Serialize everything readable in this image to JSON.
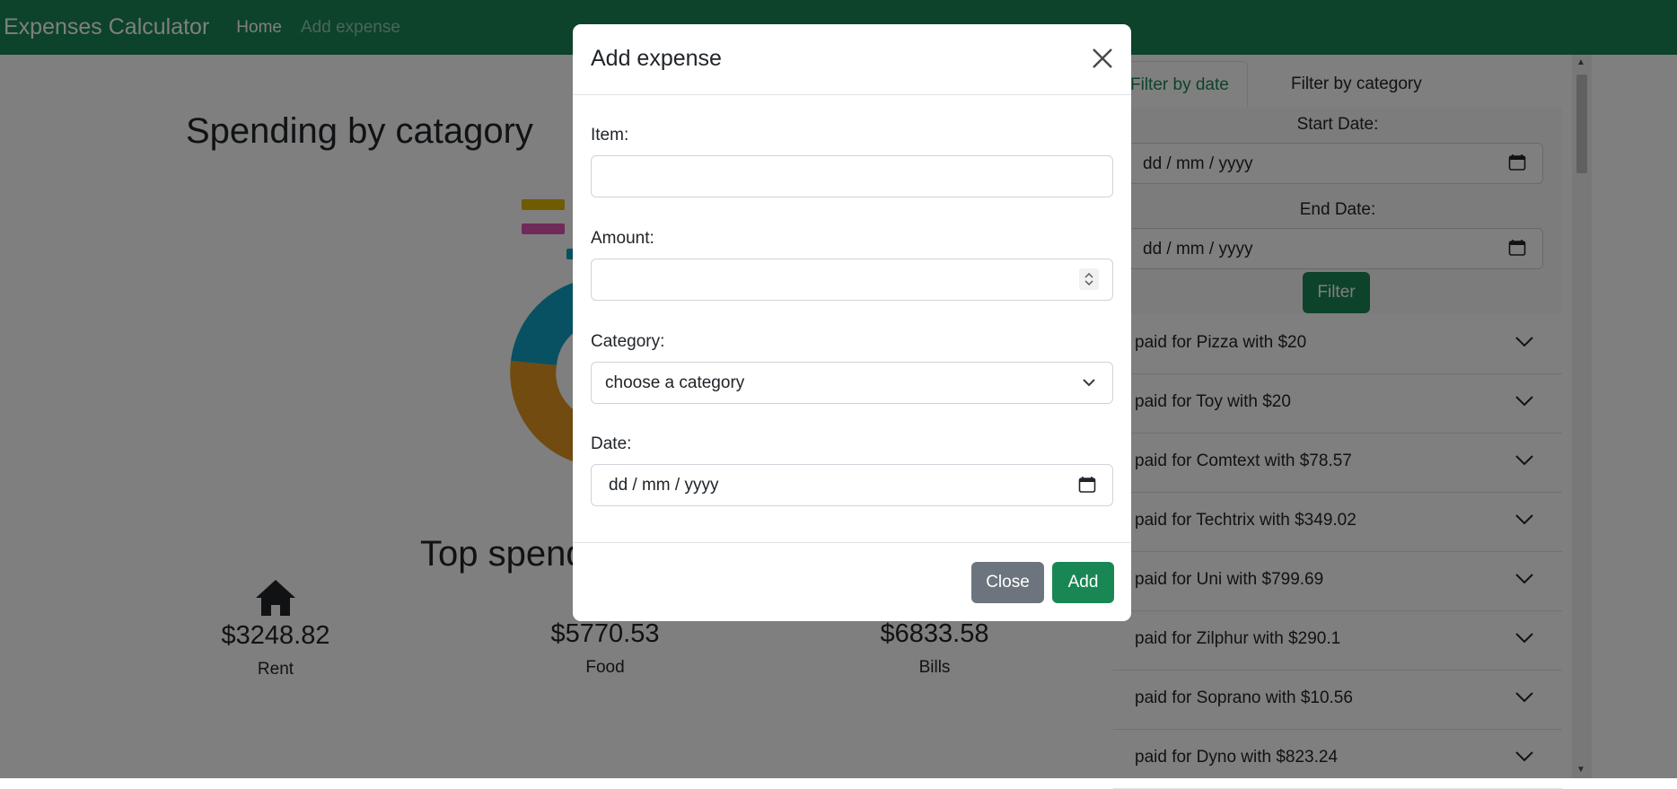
{
  "navbar": {
    "brand": "Expenses Calculator",
    "links": [
      "Home",
      "Add expense"
    ]
  },
  "main": {
    "chart_title": "Spending by catagory",
    "top_title": "Top spend",
    "top_spending": [
      {
        "icon": "house-icon",
        "amount": "$3248.82",
        "label": "Rent"
      },
      {
        "amount": "$5770.53",
        "label": "Food"
      },
      {
        "amount": "$6833.58",
        "label": "Bills"
      }
    ]
  },
  "sidebar": {
    "tabs": [
      "Filter by date",
      "Filter by category"
    ],
    "start_label": "Start Date:",
    "end_label": "End Date:",
    "date_placeholder": "dd / mm / yyyy",
    "filter_button": "Filter",
    "expenses": [
      "paid for Pizza with $20",
      "paid for Toy with $20",
      "paid for Comtext with $78.57",
      "paid for Techtrix with $349.02",
      "paid for Uni with $799.69",
      "paid for Zilphur with $290.1",
      "paid for Soprano with $10.56",
      "paid for Dyno with $823.24"
    ]
  },
  "modal": {
    "title": "Add expense",
    "item_label": "Item:",
    "amount_label": "Amount:",
    "category_label": "Category:",
    "category_value": "choose a category",
    "date_label": "Date:",
    "date_placeholder": "dd / mm / yyyy",
    "close_button": "Close",
    "add_button": "Add"
  },
  "colors": {
    "primary": "#198754",
    "secondary": "#6c757d",
    "legend_yellow": "#e0b700",
    "legend_pink": "#e055b5",
    "donut_teal": "#0fa3c4",
    "donut_orange": "#e3961f"
  }
}
